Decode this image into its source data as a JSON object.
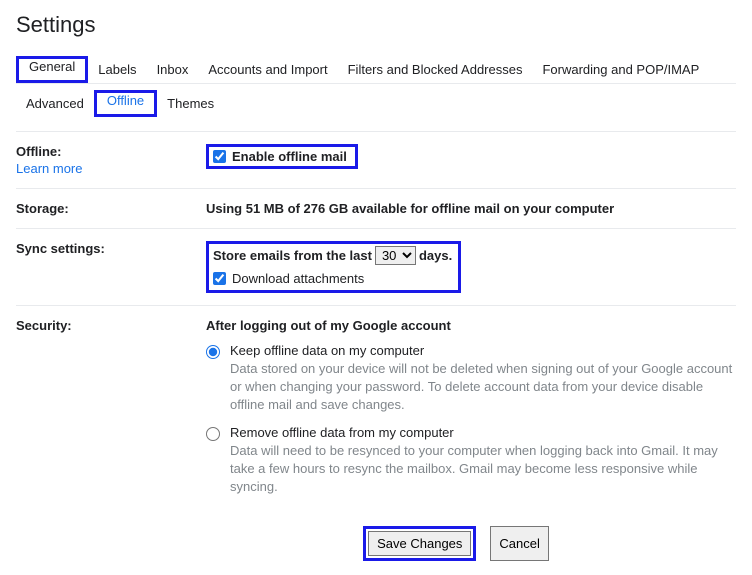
{
  "page_title": "Settings",
  "tabs": {
    "general": "General",
    "labels": "Labels",
    "inbox": "Inbox",
    "accounts": "Accounts and Import",
    "filters": "Filters and Blocked Addresses",
    "forwarding": "Forwarding and POP/IMAP",
    "advanced": "Advanced",
    "offline": "Offline",
    "themes": "Themes"
  },
  "offline": {
    "label": "Offline:",
    "learn_more": "Learn more",
    "enable_label": "Enable offline mail"
  },
  "storage": {
    "label": "Storage:",
    "text": "Using 51 MB of 276 GB available for offline mail on your computer"
  },
  "sync": {
    "label": "Sync settings:",
    "store_prefix": "Store emails from the last",
    "store_suffix": "days.",
    "days_value": "30",
    "download_label": "Download attachments"
  },
  "security": {
    "label": "Security:",
    "heading": "After logging out of my Google account",
    "keep_title": "Keep offline data on my computer",
    "keep_desc": "Data stored on your device will not be deleted when signing out of your Google account or when changing your password. To delete account data from your device disable offline mail and save changes.",
    "remove_title": "Remove offline data from my computer",
    "remove_desc": "Data will need to be resynced to your computer when logging back into Gmail. It may take a few hours to resync the mailbox. Gmail may become less responsive while syncing."
  },
  "buttons": {
    "save": "Save Changes",
    "cancel": "Cancel"
  }
}
